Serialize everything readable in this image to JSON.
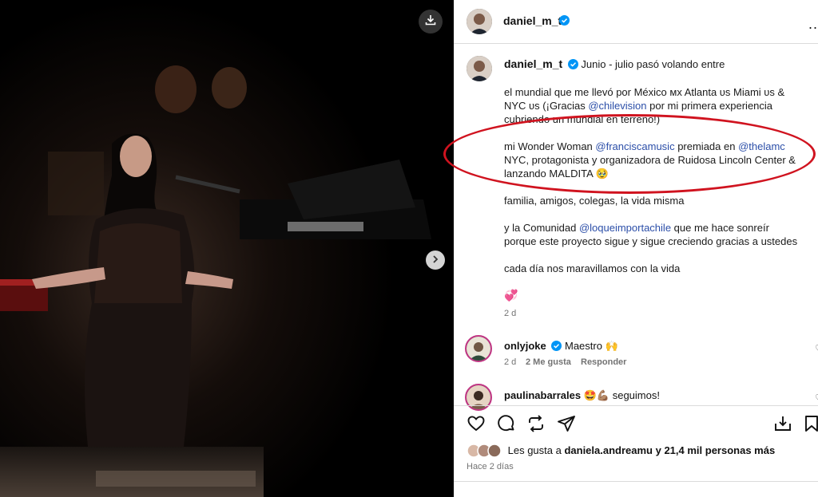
{
  "header": {
    "username": "daniel_m_t",
    "more_label": "..."
  },
  "caption": {
    "username": "daniel_m_t",
    "line1": "Junio - julio pasó volando entre",
    "p1_l1": "el mundial que me llevó por México ᴍx Atlanta ᴜs Miami ᴜs &",
    "p1_l2a": "NYC ᴜs (¡Gracias ",
    "p1_l2_link": "@chilevision",
    "p1_l2b": " por mi primera experiencia",
    "p1_l3": "cubriendo un mundial en terreno!)",
    "p2_l1a": "mi Wonder Woman ",
    "p2_l1_link1": "@franciscamusic",
    "p2_l1b": " premiada en ",
    "p2_l1_link2": "@thelamc",
    "p2_l2": "NYC, protagonista y organizadora de Ruidosa Lincoln Center &",
    "p2_l3": "lanzando MALDITA 🥹",
    "p3": "familia, amigos, colegas, la vida misma",
    "p4_l1a": "y la Comunidad ",
    "p4_l1_link": "@loqueimportachile",
    "p4_l1b": " que me hace sonreír",
    "p4_l2": "porque este proyecto sigue y sigue creciendo gracias a ustedes",
    "p5": "cada día nos maravillamos con la vida",
    "emoji": "💞",
    "time": "2 d"
  },
  "comments": [
    {
      "username": "onlyjoke",
      "text": "Maestro 🙌",
      "time": "2 d",
      "likes": "2 Me gusta",
      "reply": "Responder"
    },
    {
      "username": "paulinabarrales",
      "text": "🤩💪🏽 seguimos!"
    }
  ],
  "likes": {
    "prefix": "Les gusta a ",
    "user": "daniela.andreamu",
    "suffix": " y 21,4 mil personas más"
  },
  "posted": "Hace 2 días",
  "colors": {
    "link": "#2b4ea8",
    "verified": "#0095f6",
    "annotation": "#d0131f"
  }
}
